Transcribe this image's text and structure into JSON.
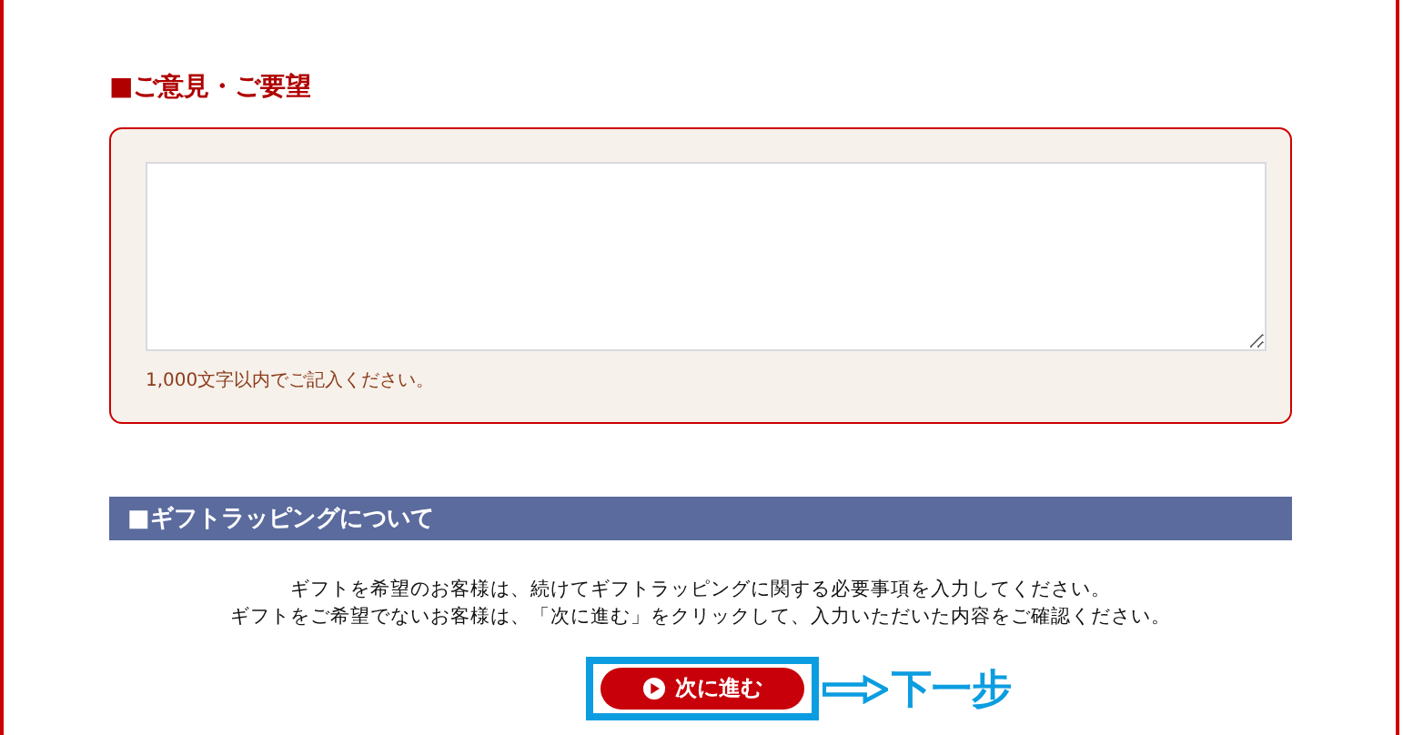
{
  "opinion": {
    "heading": "■ご意見・ご要望",
    "hint": "1,000文字以内でご記入ください。"
  },
  "gift": {
    "heading": "■ギフトラッピングについて",
    "lines": [
      "ギフトを希望のお客様は、続けてギフトラッピングに関する必要事項を入力してください。",
      "ギフトをご希望でないお客様は、「次に進む」をクリックして、入力いただいた内容をご確認ください。"
    ]
  },
  "next_button": {
    "label": "次に進む"
  },
  "annotation": {
    "label": "下一步"
  }
}
